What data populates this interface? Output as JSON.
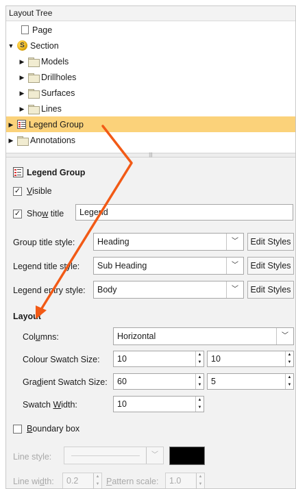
{
  "tree": {
    "header": "Layout Tree",
    "items": [
      {
        "label": "Page"
      },
      {
        "label": "Section"
      },
      {
        "label": "Models"
      },
      {
        "label": "Drillholes"
      },
      {
        "label": "Surfaces"
      },
      {
        "label": "Lines"
      },
      {
        "label": "Legend Group"
      },
      {
        "label": "Annotations"
      }
    ]
  },
  "panel": {
    "title": "Legend Group",
    "visible_label": "Visible",
    "show_title_label": "Show title",
    "title_value": "Legend",
    "group_title_style": {
      "label": "Group title style:",
      "value": "Heading"
    },
    "legend_title_style": {
      "label": "Legend title style:",
      "value": "Sub Heading"
    },
    "legend_entry_style": {
      "label": "Legend entry style:",
      "value": "Body"
    },
    "edit_styles": "Edit Styles",
    "layout_heading": "Layout",
    "columns": {
      "label": "Columns:",
      "value": "Horizontal"
    },
    "colour_swatch_size": {
      "label": "Colour Swatch Size:",
      "w": "10",
      "h": "10"
    },
    "gradient_swatch_size": {
      "label": "Gradient Swatch Size:",
      "w": "60",
      "h": "5"
    },
    "swatch_width": {
      "label": "Swatch Width:",
      "value": "10"
    },
    "boundary_box_label": "Boundary box",
    "line_style_label": "Line style:",
    "line_color": "#000000",
    "line_width": {
      "label": "Line width:",
      "value": "0.2"
    },
    "pattern_scale": {
      "label": "Pattern scale:",
      "value": "1.0"
    }
  },
  "colors": {
    "selection": "#fbd27a",
    "annotation_arrow": "#f25a16"
  }
}
